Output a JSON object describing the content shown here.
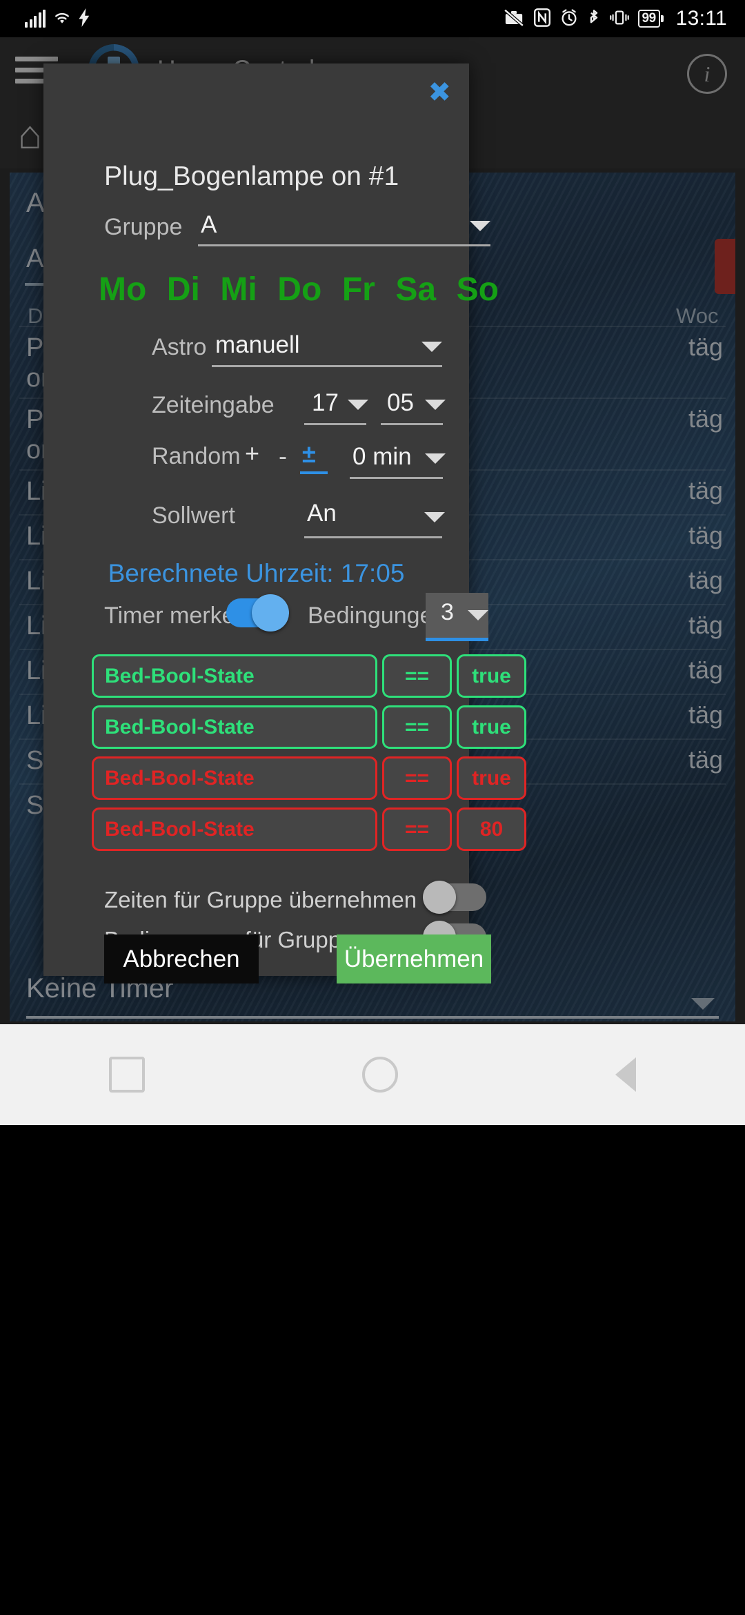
{
  "status_bar": {
    "time": "13:11",
    "battery_percent": "99",
    "icons": [
      "signal-bars-icon",
      "wifi-icon",
      "flash-icon",
      "no-briefcase-icon",
      "nfc-icon",
      "alarm-icon",
      "bluetooth-icon",
      "vibrate-icon",
      "battery-icon"
    ]
  },
  "app": {
    "title": "Home Control",
    "menu_icon": "hamburger-menu-icon",
    "info_icon": "info-icon",
    "home_icon": "home-icon",
    "background": {
      "heading": "At",
      "tab": "Al",
      "col_device": "Dev",
      "col_week": "Woc",
      "rows": [
        {
          "name": "Plu\non",
          "tag": "täg"
        },
        {
          "name": "Plu\non",
          "tag": "täg"
        },
        {
          "name": "Lic",
          "tag": "täg"
        },
        {
          "name": "Lic",
          "tag": "täg"
        },
        {
          "name": "Lic",
          "tag": "täg"
        },
        {
          "name": "Lic",
          "tag": "täg"
        },
        {
          "name": "Lic",
          "tag": "täg"
        },
        {
          "name": "Lic",
          "tag": "täg"
        },
        {
          "name": "Sw",
          "tag": "täg"
        },
        {
          "name": "Sw",
          "tag": ""
        }
      ],
      "footer": "Keine Timer"
    }
  },
  "dialog": {
    "close_label": "✖",
    "title": "Plug_Bogenlampe on #1",
    "gruppe": {
      "label": "Gruppe",
      "value": "A"
    },
    "weekdays": [
      {
        "label": "Mo",
        "active": true
      },
      {
        "label": "Di",
        "active": true
      },
      {
        "label": "Mi",
        "active": true
      },
      {
        "label": "Do",
        "active": true
      },
      {
        "label": "Fr",
        "active": true
      },
      {
        "label": "Sa",
        "active": true
      },
      {
        "label": "So",
        "active": true
      }
    ],
    "astro": {
      "label": "Astro",
      "value": "manuell"
    },
    "zeiteingabe": {
      "label": "Zeiteingabe",
      "hour": "17",
      "minute": "05"
    },
    "random": {
      "label": "Random",
      "plus": "+",
      "minus": "-",
      "plusminus": "±",
      "value": "0 min"
    },
    "sollwert": {
      "label": "Sollwert",
      "value": "An"
    },
    "berechnete_uhrzeit": "Berechnete Uhrzeit: 17:05",
    "timer_merken": {
      "label": "Timer merken",
      "on": true
    },
    "bedingungen": {
      "label": "Bedingungen",
      "count": "3"
    },
    "conditions": [
      {
        "name": "Bed-Bool-State",
        "op": "==",
        "value": "true",
        "color": "green"
      },
      {
        "name": "Bed-Bool-State",
        "op": "==",
        "value": "true",
        "color": "green"
      },
      {
        "name": "Bed-Bool-State",
        "op": "==",
        "value": "true",
        "color": "red"
      },
      {
        "name": "Bed-Bool-State",
        "op": "==",
        "value": "80",
        "color": "red"
      }
    ],
    "apply_times_group": {
      "label": "Zeiten für Gruppe übernehmen",
      "on": false
    },
    "apply_cond_group": {
      "label": "Bedingungen für Gruppe übernehmen",
      "on": false
    },
    "cancel_label": "Abbrechen",
    "apply_label": "Übernehmen"
  },
  "nav_bar": {
    "recents_icon": "square-icon",
    "home_icon": "circle-icon",
    "back_icon": "triangle-back-icon"
  },
  "colors": {
    "accent_blue": "#2e90e6",
    "green_weekday": "#15a015",
    "green_chip": "#2ee07a",
    "red_chip": "#e02424",
    "apply_green": "#5cb85c",
    "dialog_bg": "#3a3a3a"
  }
}
